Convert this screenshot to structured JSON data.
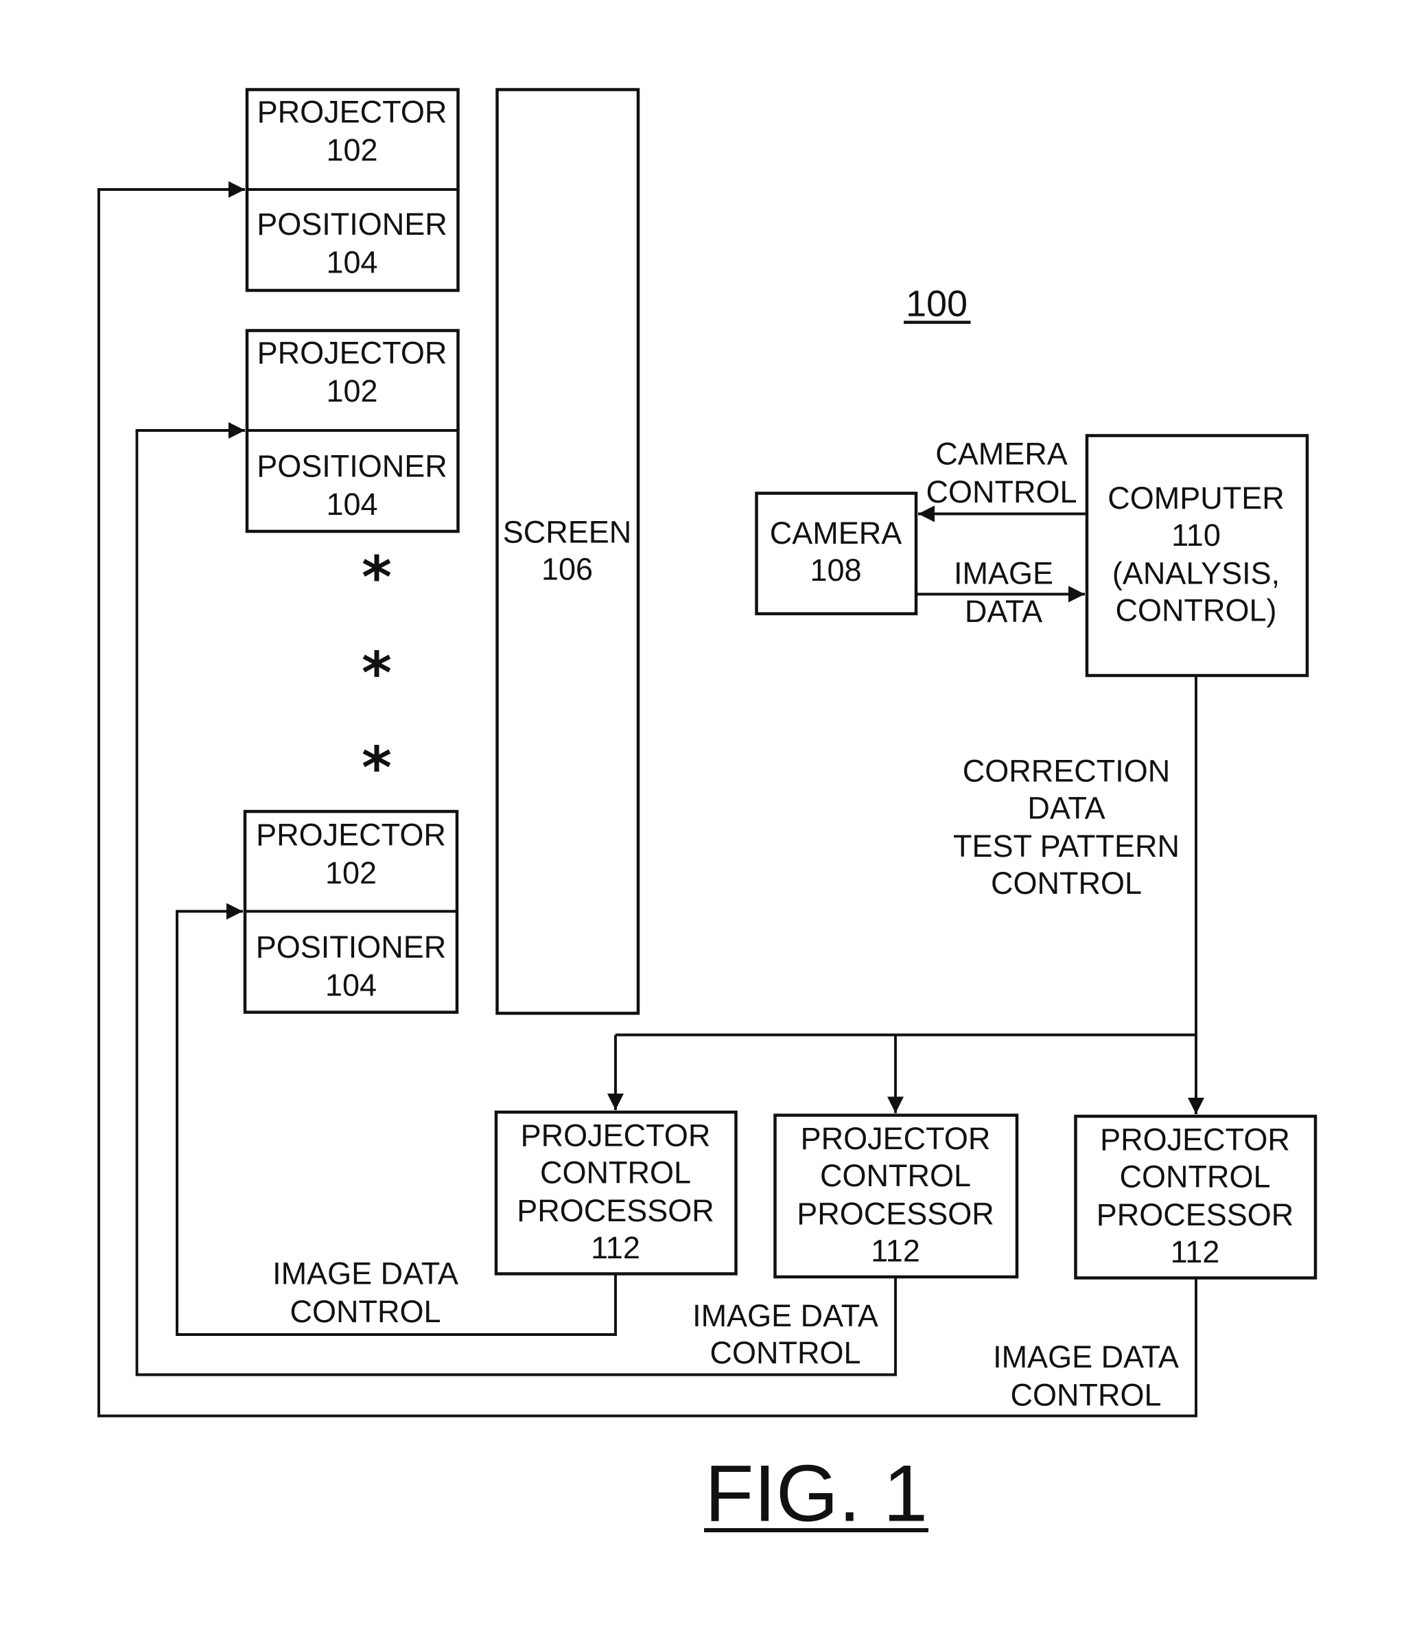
{
  "figure": {
    "system_ref": "100",
    "caption": "FIG. 1"
  },
  "projector_units": [
    {
      "projector": {
        "name": "PROJECTOR",
        "ref": "102"
      },
      "positioner": {
        "name": "POSITIONER",
        "ref": "104"
      }
    },
    {
      "projector": {
        "name": "PROJECTOR",
        "ref": "102"
      },
      "positioner": {
        "name": "POSITIONER",
        "ref": "104"
      }
    },
    {
      "projector": {
        "name": "PROJECTOR",
        "ref": "102"
      },
      "positioner": {
        "name": "POSITIONER",
        "ref": "104"
      }
    }
  ],
  "ellipsis_marks": [
    "*",
    "*",
    "*"
  ],
  "screen": {
    "name": "SCREEN",
    "ref": "106"
  },
  "camera": {
    "name": "CAMERA",
    "ref": "108"
  },
  "computer": {
    "lines": [
      "COMPUTER",
      "110",
      "(ANALYSIS,",
      "CONTROL)"
    ]
  },
  "links": {
    "camera_control": [
      "CAMERA",
      "CONTROL"
    ],
    "image_data": [
      "IMAGE",
      "DATA"
    ],
    "correction": [
      "CORRECTION",
      "DATA",
      "TEST PATTERN",
      "CONTROL"
    ],
    "image_data_control": [
      "IMAGE DATA",
      "CONTROL"
    ]
  },
  "processors": [
    {
      "lines": [
        "PROJECTOR",
        "CONTROL",
        "PROCESSOR",
        "112"
      ]
    },
    {
      "lines": [
        "PROJECTOR",
        "CONTROL",
        "PROCESSOR",
        "112"
      ]
    },
    {
      "lines": [
        "PROJECTOR",
        "CONTROL",
        "PROCESSOR",
        "112"
      ]
    }
  ]
}
